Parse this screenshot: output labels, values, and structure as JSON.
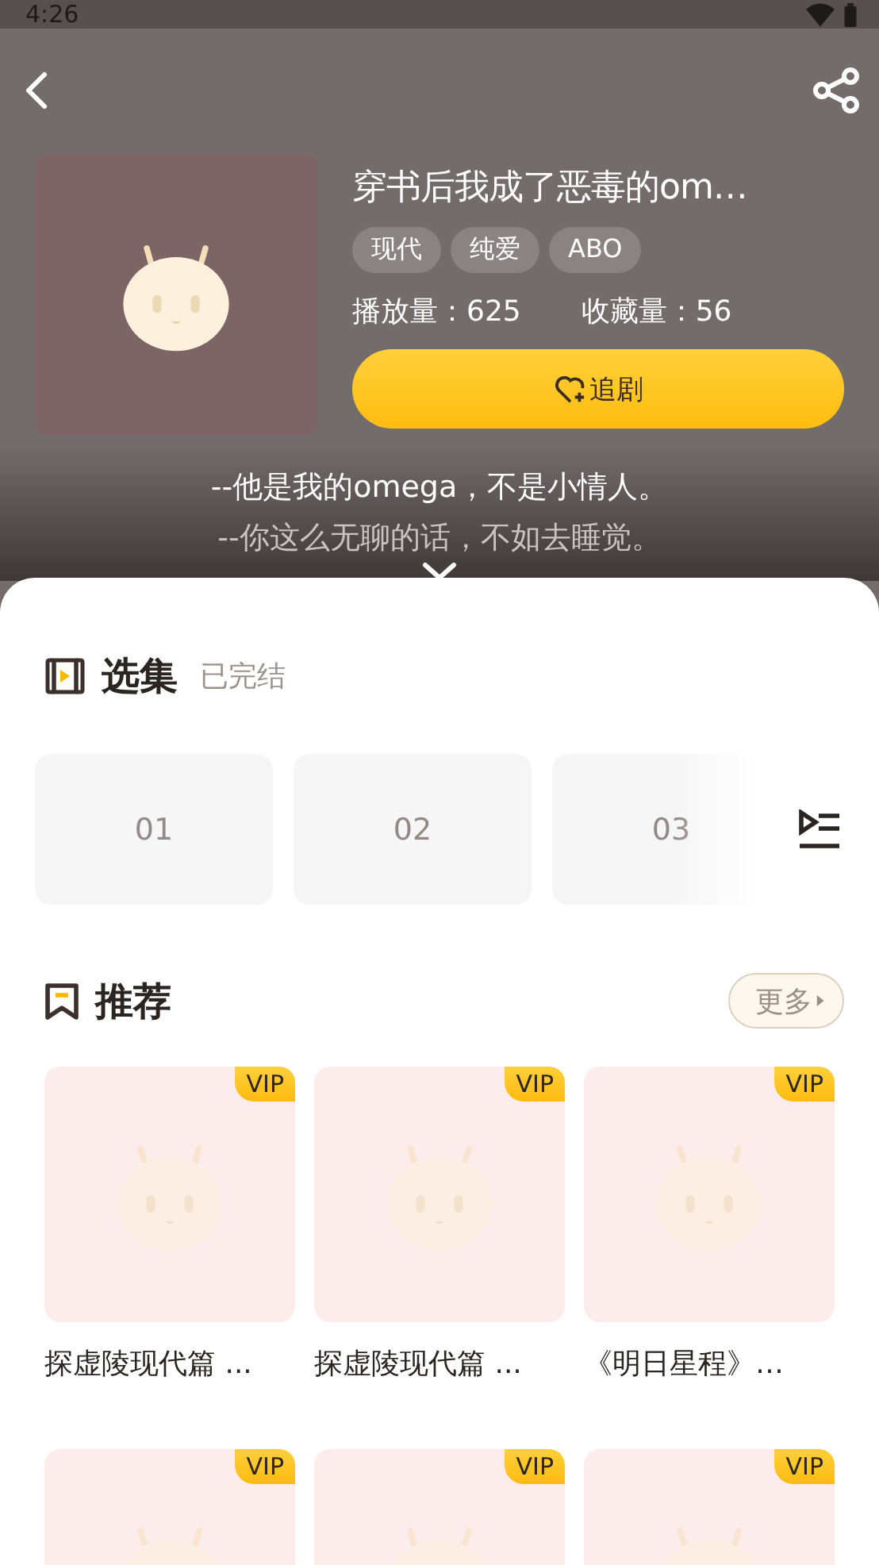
{
  "status_bar": {
    "time": "4:26"
  },
  "drama": {
    "title": "穿书后我成了恶毒的om…",
    "tags": [
      "现代",
      "纯爱",
      "ABO"
    ],
    "plays_label": "播放量：",
    "plays": "625",
    "favorites_label": "收藏量：",
    "favorites": "56",
    "follow_button": "追剧",
    "quotes": [
      {
        "text": "--他是我的omega，不是小情人。",
        "dim": false
      },
      {
        "text": "--你这么无聊的话，不如去睡觉。",
        "dim": true
      }
    ]
  },
  "episodes": {
    "title": "选集",
    "status": "已完结",
    "items": [
      "01",
      "02",
      "03"
    ]
  },
  "recommendations": {
    "title": "推荐",
    "more_button": "更多",
    "items": [
      {
        "badge": "VIP",
        "title": "探虚陵现代篇 ..."
      },
      {
        "badge": "VIP",
        "title": "探虚陵现代篇 ..."
      },
      {
        "badge": "VIP",
        "title": "《明日星程》…"
      },
      {
        "badge": "VIP"
      },
      {
        "badge": "VIP"
      },
      {
        "badge": "VIP"
      }
    ]
  }
}
